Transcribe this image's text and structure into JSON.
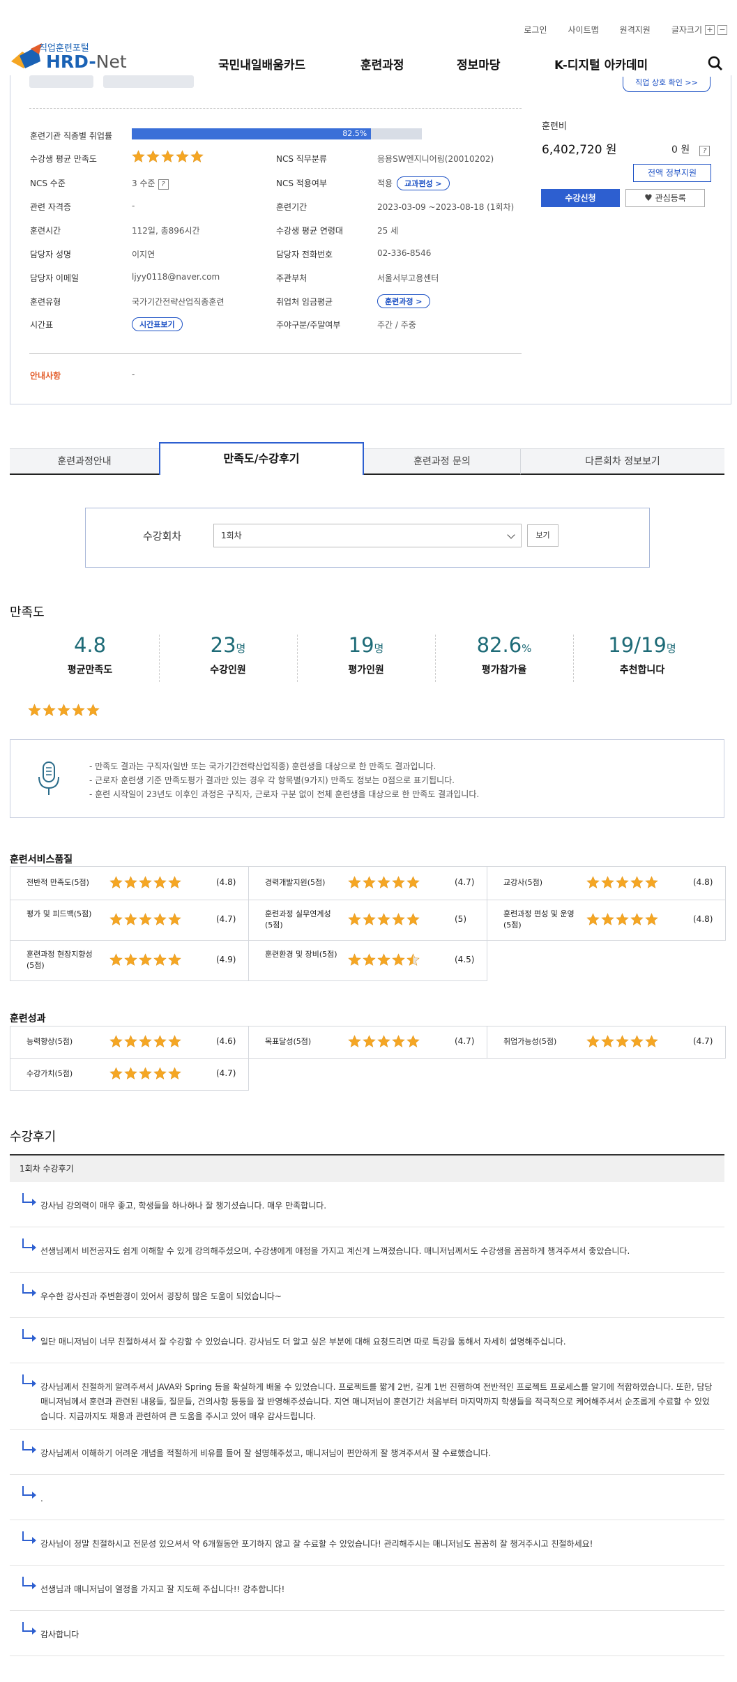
{
  "header": {
    "top_links": [
      "로그인",
      "사이트맵",
      "원격지원",
      "글자크기"
    ],
    "font_plus": "+",
    "font_minus": "−",
    "logo_sub": "직업훈련포털",
    "logo_main": "HRD-",
    "logo_net": "Net",
    "nav": [
      "국민내일배움카드",
      "훈련과정",
      "정보마당",
      "K-디지털 아카데미"
    ]
  },
  "detail": {
    "cert_btn": "직업 상호 확인 >>",
    "rows": {
      "employment_rate_label": "훈련기관 직종별 취업률",
      "employment_rate": "82.5%",
      "employment_rate_pct": 82.5,
      "satisfaction_label": "수강생 평균 만족도",
      "satisfaction_stars": 5,
      "ncs_class_label": "NCS 직무분류",
      "ncs_class": "응용SW엔지니어링(20010202)",
      "ncs_level_label": "NCS 수준",
      "ncs_level": "3 수준",
      "ncs_apply_label": "NCS 적용여부",
      "ncs_apply": "적용",
      "ncs_apply_btn": "교과편성 >",
      "cert_label": "관련 자격증",
      "cert": "-",
      "period_label": "훈련기간",
      "period": "2023-03-09 ~2023-08-18 (1회차)",
      "hours_label": "훈련시간",
      "hours": "112일, 총896시간",
      "age_label": "수강생 평균 연령대",
      "age": "25 세",
      "manager_label": "담당자 성명",
      "manager": "이지연",
      "phone_label": "담당자 전화번호",
      "phone": "02-336-8546",
      "email_label": "담당자 이메일",
      "email": "ljyy0118@naver.com",
      "ministry_label": "주관부처",
      "ministry": "서울서부고용센터",
      "type_label": "훈련유형",
      "type": "국가기간전략산업직종훈련",
      "wage_label": "취업처 임금평균",
      "wage_btn": "훈련과정 >",
      "timetable_label": "시간표",
      "timetable_btn": "시간표보기",
      "weekday_label": "주야구분/주말여부",
      "weekday": "주간 / 주중",
      "notice_label": "안내사항",
      "notice": "-"
    },
    "fee_title": "훈련비",
    "fee": "6,402,720 원",
    "gov_fee": "0 원",
    "gov_btn": "전액 정부지원",
    "apply_btn": "수강신청",
    "fav_btn": "관심등록"
  },
  "tabs": [
    "훈련과정안내",
    "만족도/수강후기",
    "훈련과정 문의",
    "다른회차 정보보기"
  ],
  "session": {
    "label": "수강회차",
    "selected": "1회차",
    "view_btn": "보기"
  },
  "satisfaction": {
    "title": "만족도",
    "stats": [
      {
        "num": "4.8",
        "unit": "",
        "label": "평균만족도"
      },
      {
        "num": "23",
        "unit": "명",
        "label": "수강인원"
      },
      {
        "num": "19",
        "unit": "명",
        "label": "평가인원"
      },
      {
        "num": "82.6",
        "unit": "%",
        "label": "평가참가율"
      },
      {
        "num": "19/19",
        "unit": "명",
        "label": "추천합니다"
      }
    ],
    "stars": 5,
    "notices": [
      "- 만족도 결과는 구직자(일반 또는 국가기간전략산업직종) 훈련생을 대상으로 한 만족도 결과입니다.",
      "- 근로자 훈련생 기준 만족도평가 결과만 있는 경우 각 항목별(9가지) 만족도 정보는 0점으로 표기됩니다.",
      "- 훈련 시작일이 23년도 이후인 과정은 구직자, 근로자 구분 없이 전체 훈련생을 대상으로 한 만족도 결과입니다."
    ]
  },
  "service_quality": {
    "title": "훈련서비스품질",
    "items": [
      {
        "label": "전반적 만족도(5점)",
        "score": "(4.8)",
        "stars": 5
      },
      {
        "label": "경력개발지원(5점)",
        "score": "(4.7)",
        "stars": 5
      },
      {
        "label": "교강사(5점)",
        "score": "(4.8)",
        "stars": 5
      },
      {
        "label": "평가 및 피드백(5점)",
        "score": "(4.7)",
        "stars": 5
      },
      {
        "label": "훈련과정 실무연계성(5점)",
        "score": "(5)",
        "stars": 5
      },
      {
        "label": "훈련과정 편성 및 운영(5점)",
        "score": "(4.8)",
        "stars": 5
      },
      {
        "label": "훈련과정 현장지향성(5점)",
        "score": "(4.9)",
        "stars": 5
      },
      {
        "label": "훈련환경 및 장비(5점)",
        "score": "(4.5)",
        "stars": 4.5
      }
    ]
  },
  "outcome": {
    "title": "훈련성과",
    "items": [
      {
        "label": "능력향상(5점)",
        "score": "(4.6)",
        "stars": 5
      },
      {
        "label": "목표달성(5점)",
        "score": "(4.7)",
        "stars": 5
      },
      {
        "label": "취업가능성(5점)",
        "score": "(4.7)",
        "stars": 5
      },
      {
        "label": "수강가치(5점)",
        "score": "(4.7)",
        "stars": 5
      }
    ]
  },
  "reviews": {
    "title": "수강후기",
    "head": "1회차 수강후기",
    "items": [
      "강사님 강의력이 매우 좋고, 학생들을 하나하나 잘 챙기셨습니다. 매우 만족합니다.",
      "선생님께서 비전공자도 쉽게 이해할 수 있게 강의해주셨으며, 수강생에게 애정을 가지고 계신게 느껴졌습니다. 매니저님께서도 수강생을 꼼꼼하게 챙겨주셔서 좋았습니다.",
      "우수한 강사진과 주변환경이 있어서 굉장히 많은 도움이 되었습니다~",
      "일단 매니저님이 너무 친절하셔서 잘 수강할 수 있었습니다. 강사님도 더 알고 싶은 부분에 대해 요청드리면 따로 특강을 통해서 자세히 설명해주십니다.",
      "강사님께서 친절하게 알려주셔서 JAVA와 Spring 등을 확실하게 배울 수 있었습니다. 프로젝트를 짧게 2번, 길게 1번 진행하여 전반적인 프로젝트 프로세스를 알기에 적합하였습니다. 또한, 담당 매니저님께서 훈련과 관련된 내용들, 질문들, 건의사항 등등을 잘 반영해주셨습니다. 지연 매니저님이 훈련기간 처음부터 마지막까지 학생들을 적극적으로 케어해주셔서 순조롭게 수료할 수 있었습니다. 지금까지도 채용과 관련하여 큰 도움을 주시고 있어 매우 감사드립니다.",
      "강사님께서 이해하기 어려운 개념을 적절하게 비유를 들어 잘 설명해주셨고, 매니저님이 편안하게 잘 챙겨주셔서 잘 수료했습니다.",
      ".",
      "강사님이 정말 친절하시고 전문성 있으셔서 약 6개월동안 포기하지 않고 잘 수료할 수 있었습니다! 관리해주시는 매니저님도 꼼꼼히 잘 챙겨주시고 친절하세요!",
      "선생님과 매니저님이 열정을 가지고 잘 지도해 주십니다!! 강추합니다!",
      "감사합니다"
    ]
  },
  "colors": {
    "accent": "#2d5fd0",
    "teal": "#1e6b77",
    "star": "#f5a623",
    "notice_label": "#e35d2a"
  }
}
